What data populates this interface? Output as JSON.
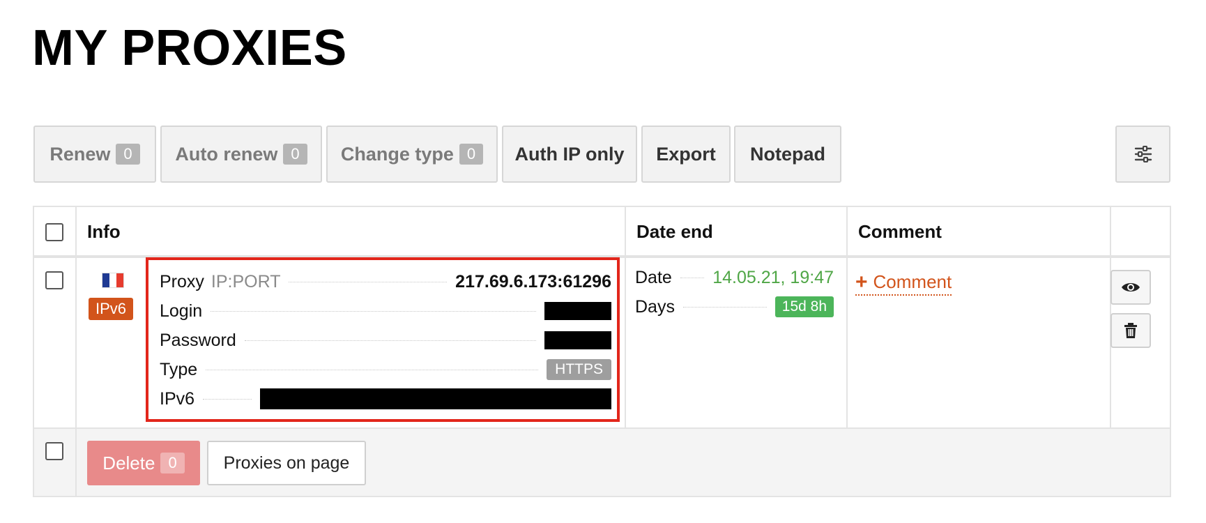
{
  "page": {
    "title": "MY PROXIES"
  },
  "toolbar": {
    "renew": {
      "label": "Renew",
      "count": "0"
    },
    "auto_renew": {
      "label": "Auto renew",
      "count": "0"
    },
    "change_type": {
      "label": "Change type",
      "count": "0"
    },
    "auth_ip_only": {
      "label": "Auth IP only"
    },
    "export": {
      "label": "Export"
    },
    "notepad": {
      "label": "Notepad"
    },
    "settings_icon": "sliders-icon"
  },
  "table": {
    "headers": {
      "info": "Info",
      "date_end": "Date end",
      "comment": "Comment"
    },
    "rows": [
      {
        "flag": {
          "icon": "flag-france-icon",
          "colors": [
            "#1f3a93",
            "#ffffff",
            "#e63b2e"
          ]
        },
        "ip_version": "IPv6",
        "proxy_label": "Proxy",
        "proxy_sublabel": "IP:PORT",
        "proxy_value": "217.69.6.173:61296",
        "login_label": "Login",
        "password_label": "Password",
        "type_label": "Type",
        "type_value": "HTTPS",
        "ipv6_label": "IPv6",
        "date_label": "Date",
        "date_value": "14.05.21, 19:47",
        "days_label": "Days",
        "days_value": "15d 8h",
        "comment_link": "Comment"
      }
    ]
  },
  "footer": {
    "delete": {
      "label": "Delete",
      "count": "0"
    },
    "proxies_on_page": "Proxies on page"
  },
  "colors": {
    "accent_orange": "#d2541b",
    "highlight_red": "#e2261b",
    "date_green": "#4fa646",
    "days_badge_green": "#4cb55a",
    "delete_button": "#e88a8a"
  }
}
